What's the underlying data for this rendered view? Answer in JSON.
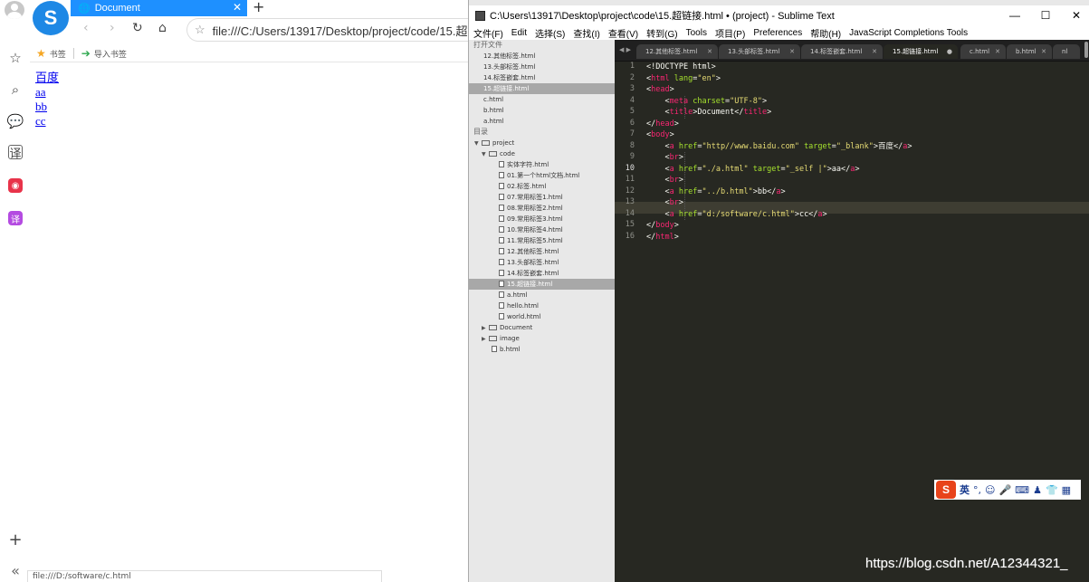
{
  "browser": {
    "tab_title": "Document",
    "address": "file:///C:/Users/13917/Desktop/project/code/15.超链接",
    "bookmarks": [
      "书签",
      "导入书签"
    ],
    "links": [
      "百度",
      "aa",
      "bb",
      "cc"
    ],
    "status_url": "file:///D:/software/c.html"
  },
  "sublime": {
    "title": "C:\\Users\\13917\\Desktop\\project\\code\\15.超链接.html • (project) - Sublime Text",
    "menu": [
      "文件(F)",
      "Edit",
      "选择(S)",
      "查找(I)",
      "查看(V)",
      "转到(G)",
      "Tools",
      "项目(P)",
      "Preferences",
      "帮助(H)",
      "JavaScript Completions Tools"
    ],
    "open_files_header": "打开文件",
    "open_files": [
      "12.其他标签.html",
      "13.头部标签.html",
      "14.标签嵌套.html",
      "15.超链接.html",
      "c.html",
      "b.html",
      "a.html"
    ],
    "folders_header": "目录",
    "tree": [
      {
        "label": "project",
        "kind": "folder-open"
      },
      {
        "label": "code",
        "kind": "folder-open"
      },
      {
        "label": "实体字符.html",
        "kind": "file"
      },
      {
        "label": "01.第一个html文档.html",
        "kind": "file"
      },
      {
        "label": "02.标签.html",
        "kind": "file"
      },
      {
        "label": "07.常用标签1.html",
        "kind": "file"
      },
      {
        "label": "08.常用标签2.html",
        "kind": "file"
      },
      {
        "label": "09.常用标签3.html",
        "kind": "file"
      },
      {
        "label": "10.常用标签4.html",
        "kind": "file"
      },
      {
        "label": "11.常用标签5.html",
        "kind": "file"
      },
      {
        "label": "12.其他标签.html",
        "kind": "file"
      },
      {
        "label": "13.头部标签.html",
        "kind": "file"
      },
      {
        "label": "14.标签嵌套.html",
        "kind": "file"
      },
      {
        "label": "15.超链接.html",
        "kind": "file"
      },
      {
        "label": "a.html",
        "kind": "file"
      },
      {
        "label": "hello.html",
        "kind": "file"
      },
      {
        "label": "world.html",
        "kind": "file"
      },
      {
        "label": "Document",
        "kind": "folder"
      },
      {
        "label": "image",
        "kind": "folder"
      },
      {
        "label": "b.html",
        "kind": "file"
      }
    ],
    "tabs": [
      "12.其他标签.html",
      "13.头部标签.html",
      "14.标签嵌套.html",
      "15.超链接.html",
      "c.html",
      "b.html",
      "nl"
    ],
    "line_numbers": [
      "1",
      "2",
      "3",
      "4",
      "5",
      "6",
      "7",
      "8",
      "9",
      "10",
      "11",
      "12",
      "13",
      "14",
      "15",
      "16"
    ]
  },
  "ime": {
    "label": "英"
  },
  "watermark": "https://blog.csdn.net/A12344321_"
}
